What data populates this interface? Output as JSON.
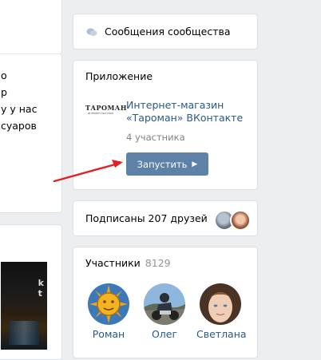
{
  "left": {
    "lines": [
      "о",
      "р",
      "у у нас",
      "суаров"
    ]
  },
  "messages": {
    "label": "Сообщения сообщества"
  },
  "app": {
    "title": "Приложение",
    "logo_text": "ТАРОМАН",
    "logo_subtext": "ИНТЕРНЕТ-МАГАЗИН",
    "name_line1": "Интернет-магазин",
    "name_line2": "«Тароман» ВКонтакте",
    "members": "4 участника",
    "launch_label": "Запустить"
  },
  "friends": {
    "label": "Подписаны 207 друзей"
  },
  "members": {
    "title": "Участники",
    "count": "8129",
    "items": [
      {
        "name": "Роман"
      },
      {
        "name": "Олег"
      },
      {
        "name": "Светлана"
      }
    ]
  },
  "colors": {
    "link": "#2a5885",
    "button": "#5e81a8",
    "arrow": "#e32020",
    "muted": "#828282"
  }
}
